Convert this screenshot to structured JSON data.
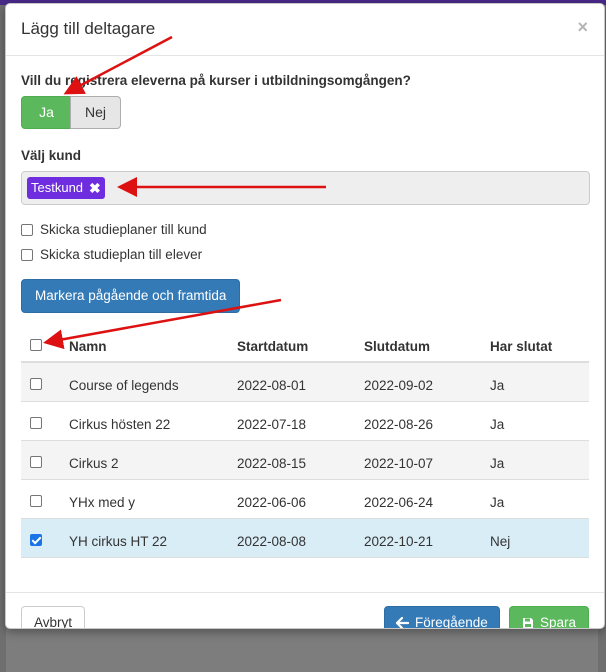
{
  "modal": {
    "title": "Lägg till deltagare",
    "close_glyph": "×"
  },
  "question": {
    "text": "Vill du registrera eleverna på kurser i utbildningsomgången?",
    "yes_label": "Ja",
    "no_label": "Nej",
    "selected": "Ja"
  },
  "customer": {
    "label": "Välj kund",
    "selected_tag": "Testkund",
    "remove_glyph": "✖"
  },
  "options": [
    {
      "label": "Skicka studieplaner till kund",
      "checked": false
    },
    {
      "label": "Skicka studieplan till elever",
      "checked": false
    }
  ],
  "mark_button": "Markera pågående och framtida",
  "table": {
    "headers": [
      "Namn",
      "Startdatum",
      "Slutdatum",
      "Har slutat"
    ],
    "rows": [
      {
        "name": "Course of legends",
        "start": "2022-08-01",
        "end": "2022-09-02",
        "ended": "Ja",
        "checked": false
      },
      {
        "name": "Cirkus hösten 22",
        "start": "2022-07-18",
        "end": "2022-08-26",
        "ended": "Ja",
        "checked": false
      },
      {
        "name": "Cirkus 2",
        "start": "2022-08-15",
        "end": "2022-10-07",
        "ended": "Ja",
        "checked": false
      },
      {
        "name": "YHx med y",
        "start": "2022-06-06",
        "end": "2022-06-24",
        "ended": "Ja",
        "checked": false
      },
      {
        "name": "YH cirkus HT 22",
        "start": "2022-08-08",
        "end": "2022-10-21",
        "ended": "Nej",
        "checked": true
      }
    ]
  },
  "footer": {
    "cancel_label": "Avbryt",
    "prev_label": "Föregående",
    "save_label": "Spara"
  },
  "colors": {
    "success": "#5cb85c",
    "primary": "#337ab7",
    "tag": "#6f2de0",
    "annotation_arrow": "#dd1111",
    "selected_row": "#d9edf7"
  }
}
